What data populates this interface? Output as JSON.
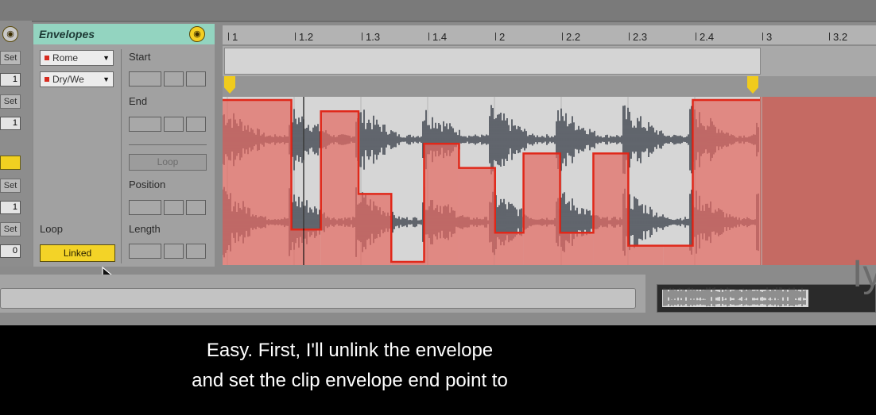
{
  "left_strip": {
    "set_labels": [
      "Set",
      "Set",
      "Set",
      "Set"
    ],
    "values": [
      "1",
      "1",
      "1",
      "0"
    ]
  },
  "envelopes": {
    "title": "Envelopes",
    "device_chooser": "Rome",
    "control_chooser": "Dry/We",
    "start_label": "Start",
    "end_label": "End",
    "loop_button": "Loop",
    "position_label": "Position",
    "length_label": "Length",
    "loop_label": "Loop",
    "linked_button": "Linked"
  },
  "ruler": {
    "markers": [
      "1",
      "1.2",
      "1.3",
      "1.4",
      "2",
      "2.2",
      "2.3",
      "2.4",
      "3",
      "3.2"
    ]
  },
  "envelope_levels": {
    "note": "",
    "steps": [
      {
        "start": 0.0,
        "end": 0.128,
        "level": 1.0
      },
      {
        "start": 0.128,
        "end": 0.183,
        "level": 0.2
      },
      {
        "start": 0.183,
        "end": 0.253,
        "level": 0.93
      },
      {
        "start": 0.253,
        "end": 0.314,
        "level": 0.42
      },
      {
        "start": 0.314,
        "end": 0.375,
        "level": 0.0
      },
      {
        "start": 0.375,
        "end": 0.44,
        "level": 0.73
      },
      {
        "start": 0.44,
        "end": 0.507,
        "level": 0.58
      },
      {
        "start": 0.507,
        "end": 0.56,
        "level": 0.18
      },
      {
        "start": 0.56,
        "end": 0.628,
        "level": 0.67
      },
      {
        "start": 0.628,
        "end": 0.69,
        "level": 0.18
      },
      {
        "start": 0.69,
        "end": 0.755,
        "level": 0.67
      },
      {
        "start": 0.755,
        "end": 0.82,
        "level": 0.1
      },
      {
        "start": 0.82,
        "end": 0.875,
        "level": 0.1
      },
      {
        "start": 0.875,
        "end": 1.0,
        "level": 1.0
      }
    ]
  },
  "overlay_text": "Iy",
  "captions": [
    "Easy. First, I'll unlink the envelope",
    "and set the clip envelope end point to"
  ],
  "colors": {
    "env_header": "#93d4c0",
    "yellow": "#f3d327",
    "envelope_red": "#e36b62",
    "wave_dark": "#2f3540"
  }
}
